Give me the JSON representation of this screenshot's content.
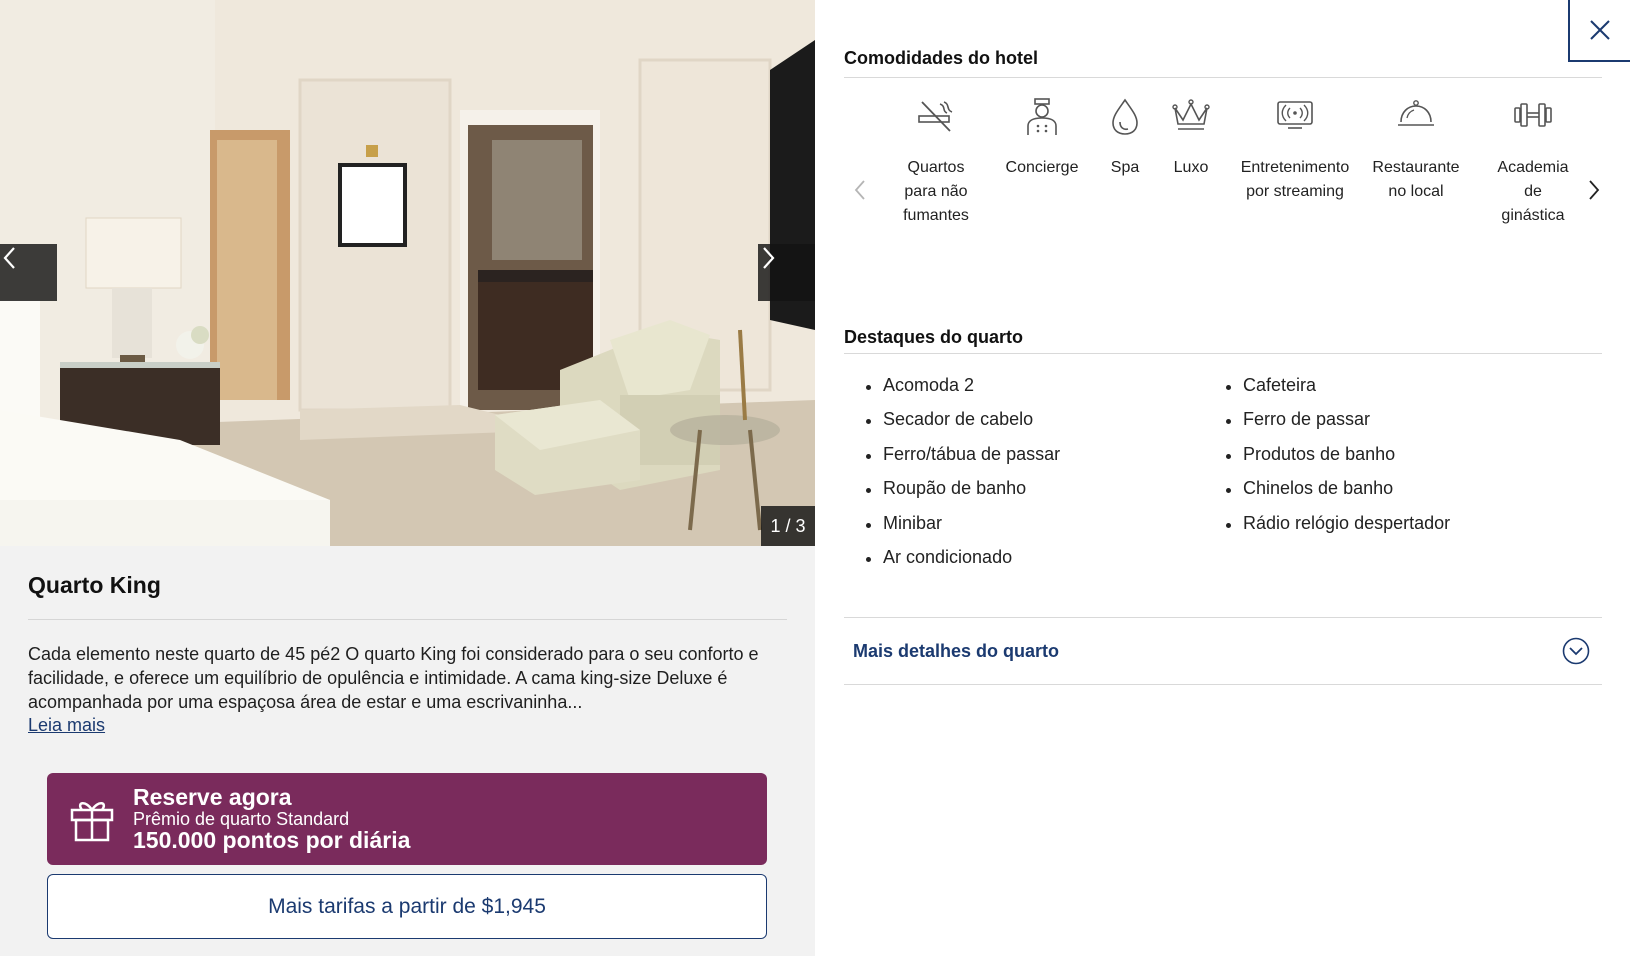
{
  "gallery": {
    "counter": "1 / 3",
    "prev_icon": "chevron-left-icon",
    "next_icon": "chevron-right-icon"
  },
  "room": {
    "title": "Quarto King",
    "description": "Cada elemento neste quarto de 45 pé2 O quarto King foi considerado para o seu conforto e facilidade, e oferece um equilíbrio de opulência e intimidade. A cama king-size Deluxe é acompanhada por uma espaçosa área de estar e uma escrivaninha...",
    "read_more": "Leia mais"
  },
  "reserve": {
    "icon": "gift-icon",
    "title": "Reserve agora",
    "subtitle": "Prêmio de quarto Standard",
    "points": "150.000 pontos por diária",
    "color": "#7a2b5c"
  },
  "rates_button": "Mais tarifas a partir de $1,945",
  "amenities": {
    "heading": "Comodidades do hotel",
    "items": [
      {
        "label": "Quartos\npara não\nfumantes",
        "icon": "no-smoking-icon"
      },
      {
        "label": "Concierge",
        "icon": "concierge-icon"
      },
      {
        "label": "Spa",
        "icon": "spa-drop-icon"
      },
      {
        "label": "Luxo",
        "icon": "crown-icon"
      },
      {
        "label": "Entretenimento\npor streaming",
        "icon": "streaming-icon"
      },
      {
        "label": "Restaurante\nno local",
        "icon": "restaurant-icon"
      },
      {
        "label": "Academia\nde\nginástica",
        "icon": "dumbbell-icon"
      }
    ]
  },
  "highlights": {
    "heading": "Destaques do quarto",
    "left": [
      "Acomoda 2",
      "Secador de cabelo",
      "Ferro/tábua de passar",
      "Roupão de banho",
      "Minibar",
      "Ar condicionado"
    ],
    "right": [
      "Cafeteira",
      "Ferro de passar",
      "Produtos de banho",
      "Chinelos de banho",
      "Rádio relógio despertador"
    ]
  },
  "more_details": "Mais detalhes do quarto",
  "colors": {
    "navy": "#1b3a70",
    "panel_bg": "#f2f2f2"
  }
}
